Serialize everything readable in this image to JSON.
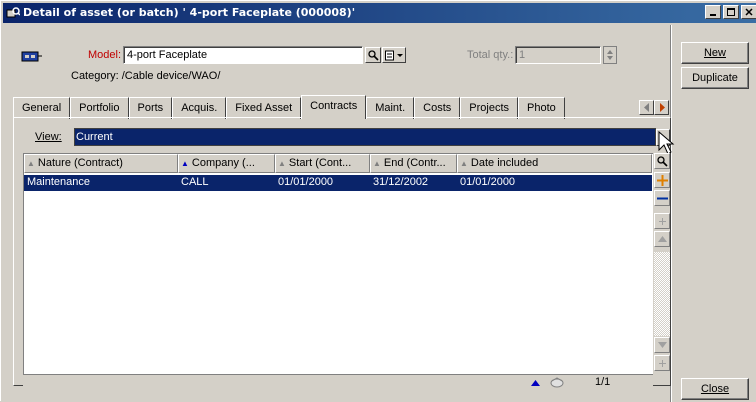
{
  "window": {
    "title": "Detail of asset (or batch) ' 4-port Faceplate (000008)'"
  },
  "form": {
    "model_label": "Model:",
    "model_value": "4-port Faceplate",
    "total_qty_label": "Total qty.:",
    "total_qty_value": "1",
    "category_text": "Category: /Cable device/WAO/"
  },
  "actions": {
    "new_label": "New",
    "duplicate_label": "Duplicate",
    "close_label": "Close"
  },
  "tabs": [
    {
      "label": "General"
    },
    {
      "label": "Portfolio"
    },
    {
      "label": "Ports"
    },
    {
      "label": "Acquis."
    },
    {
      "label": "Fixed Asset"
    },
    {
      "label": "Contracts"
    },
    {
      "label": "Maint."
    },
    {
      "label": "Costs"
    },
    {
      "label": "Projects"
    },
    {
      "label": "Photo"
    }
  ],
  "active_tab": "Contracts",
  "view": {
    "label": "View:",
    "value": "Current"
  },
  "table": {
    "columns": [
      {
        "label": "Nature (Contract)"
      },
      {
        "label": "Company (..."
      },
      {
        "label": "Start (Cont..."
      },
      {
        "label": "End (Contr..."
      },
      {
        "label": "Date included"
      }
    ],
    "rows": [
      {
        "cells": [
          "Maintenance",
          "CALL",
          "01/01/2000",
          "31/12/2002",
          "01/01/2000"
        ]
      }
    ],
    "pager": "1/1"
  },
  "colors": {
    "title_bar": "#0a246a",
    "selection": "#0a246a",
    "face": "#d4d0c8"
  }
}
